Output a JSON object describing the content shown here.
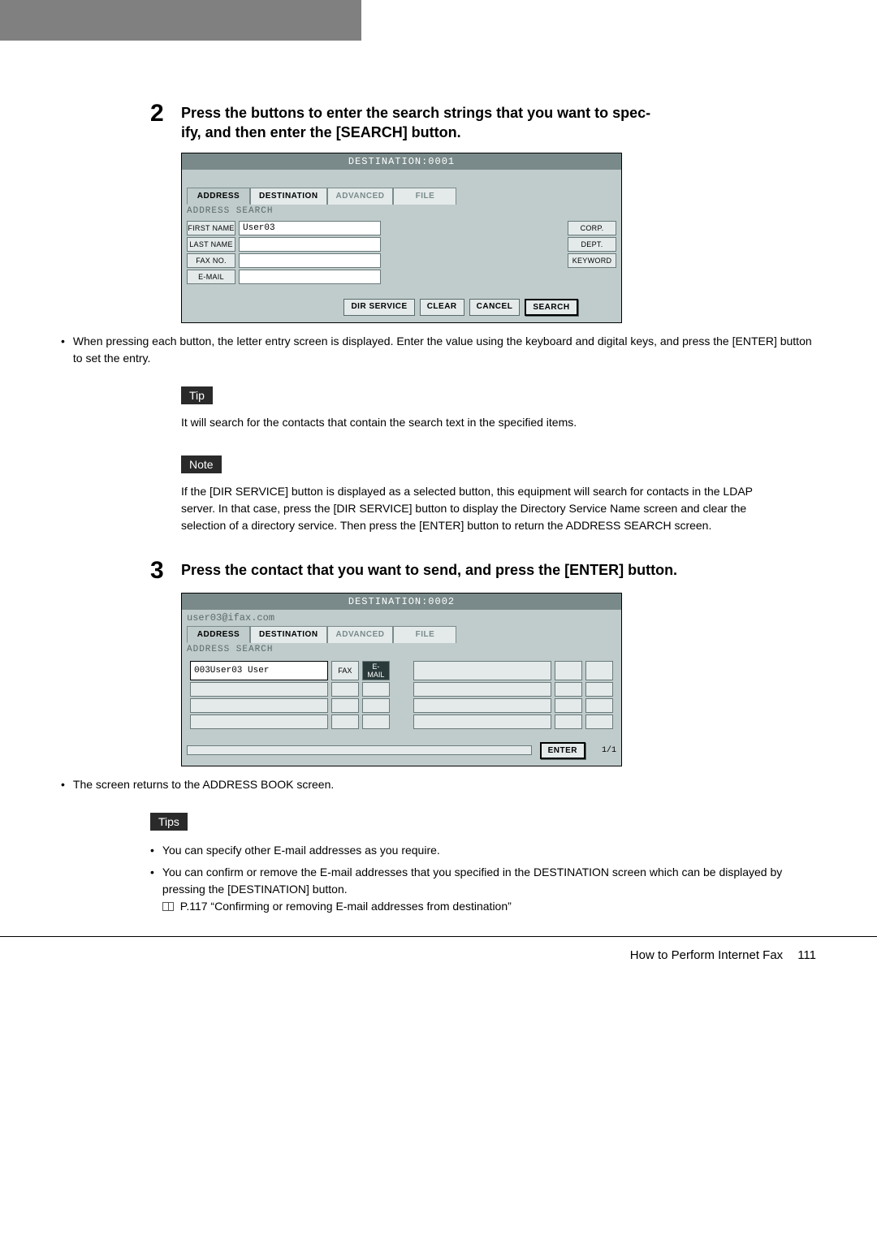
{
  "step2": {
    "number": "2",
    "title": "Press the buttons to enter the search strings that you want to spec-\nify, and then enter the [SEARCH] button.",
    "screenshot": {
      "title": "DESTINATION:0001",
      "tabs": [
        "ADDRESS",
        "DESTINATION",
        "ADVANCED",
        "FILE"
      ],
      "subtitle": "ADDRESS SEARCH",
      "left_labels": [
        "FIRST NAME",
        "LAST NAME",
        "FAX NO.",
        "E-MAIL"
      ],
      "first_name_value": "User03",
      "right_labels": [
        "CORP.",
        "DEPT.",
        "KEYWORD"
      ],
      "actions": [
        "DIR SERVICE",
        "CLEAR",
        "CANCEL",
        "SEARCH"
      ]
    },
    "bullet": "When pressing each button, the letter entry screen is displayed.  Enter the value using the keyboard and digital keys, and press the [ENTER] button to set the entry.",
    "tip_label": "Tip",
    "tip_text": "It will search for the contacts that contain the search text in the specified items.",
    "note_label": "Note",
    "note_text": "If the [DIR SERVICE] button is displayed as a selected button, this equipment will search for contacts in the LDAP server.  In that case, press the [DIR SERVICE] button to display the Directory Service Name screen and clear the selection of a directory service.  Then press the [ENTER] button to return the ADDRESS SEARCH screen."
  },
  "step3": {
    "number": "3",
    "title": "Press the contact that you want to send, and press the [ENTER] button.",
    "screenshot": {
      "title": "DESTINATION:0002",
      "dest_line": "user03@ifax.com",
      "tabs": [
        "ADDRESS",
        "DESTINATION",
        "ADVANCED",
        "FILE"
      ],
      "subtitle": "ADDRESS SEARCH",
      "row1_name": "003User03 User",
      "fax_label": "FAX",
      "email_label": "E-MAIL",
      "enter": "ENTER",
      "page": "1/1"
    },
    "bullet": "The screen returns to the ADDRESS BOOK screen.",
    "tips_label": "Tips",
    "tips": {
      "b1": "You can specify other E-mail addresses as you require.",
      "b2": "You can confirm or remove the E-mail addresses that you specified in the DESTINATION screen which can be displayed by pressing the [DESTINATION] button.",
      "ref": "P.117 “Confirming or removing E-mail addresses from destination”"
    }
  },
  "footer": {
    "text": "How to Perform Internet Fax",
    "page": "111"
  }
}
